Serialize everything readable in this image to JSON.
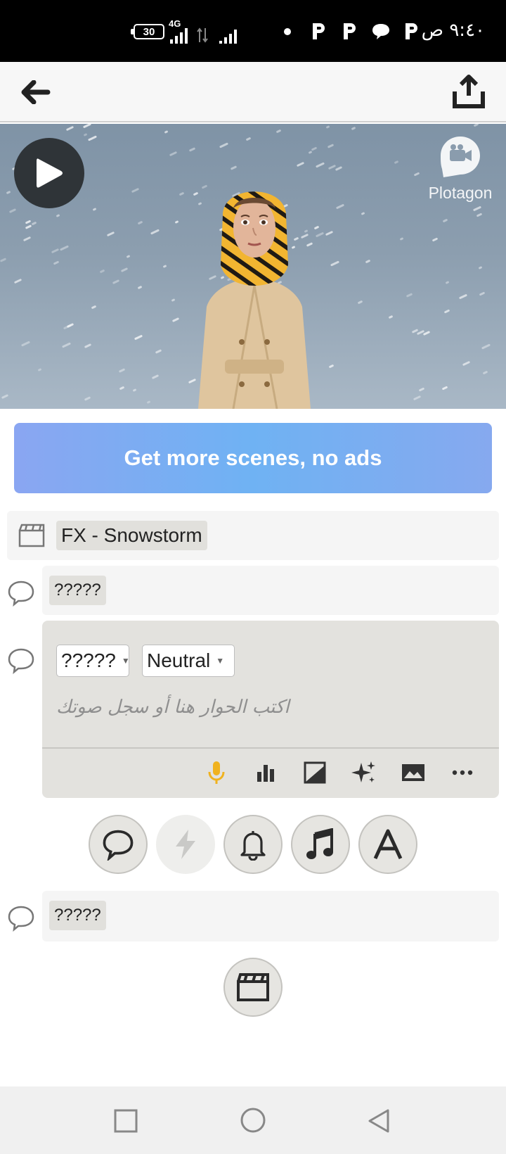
{
  "status_bar": {
    "time": "٩:٤٠ ص",
    "battery": "30",
    "network": "4G"
  },
  "video": {
    "logo_text": "Plotagon"
  },
  "promo": {
    "label": "Get more scenes, no ads"
  },
  "script": {
    "scene_label": "FX - Snowstorm",
    "line1_character": "?????",
    "editor": {
      "character": "?????",
      "mood": "Neutral",
      "placeholder": "اكتب الحوار هنا أو سجل صوتك"
    },
    "line2_character": "?????"
  },
  "colors": {
    "accent_mic": "#f0b21e",
    "promo_gradient_start": "#8aa6f2",
    "promo_gradient_end": "#6fb2f3"
  },
  "icons": {
    "back": "arrow-left-icon",
    "share": "share-upload-icon",
    "play": "play-icon",
    "mic": "microphone-icon",
    "stats": "bar-chart-icon",
    "image": "image-icon",
    "effects": "sparkles-icon",
    "scene": "landscape-icon",
    "more": "more-dots-icon"
  }
}
